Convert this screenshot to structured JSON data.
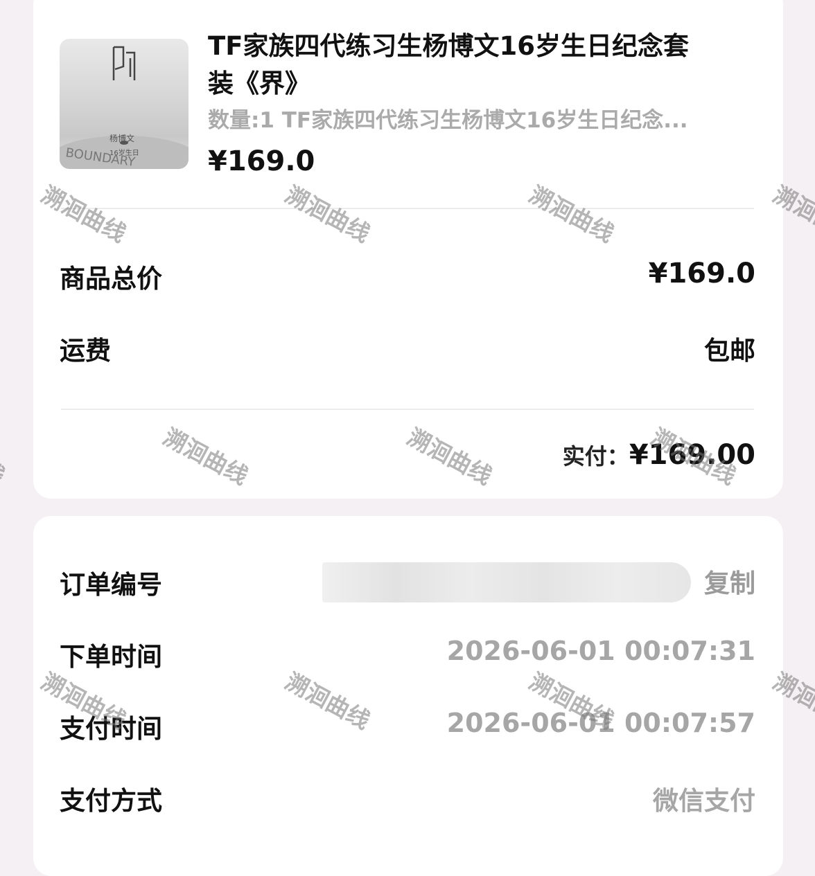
{
  "product": {
    "title": "TF家族四代练习生杨博文16岁生日纪念套装《界》",
    "subtitle": "数量:1 TF家族四代练习生杨博文16岁生日纪念...",
    "price": "¥169.0",
    "thumb_text": [
      "杨博文",
      "16岁生日",
      "BOUNDARY"
    ]
  },
  "summary": {
    "total_label": "商品总价",
    "total_value": "¥169.0",
    "shipping_label": "运费",
    "shipping_value": "包邮",
    "paid_label": "实付：",
    "paid_value": "¥169.00"
  },
  "order": {
    "number_label": "订单编号",
    "copy_label": "复制",
    "created_label": "下单时间",
    "created_value": "2026-06-01 00:07:31",
    "paid_time_label": "支付时间",
    "paid_time_value": "2026-06-01 00:07:57",
    "method_label": "支付方式",
    "method_value": "微信支付"
  },
  "watermark": "溯洄曲线",
  "colors": {
    "page_bg": "#f5f0f4",
    "card_bg": "#ffffff",
    "muted": "#9b9b9b"
  }
}
